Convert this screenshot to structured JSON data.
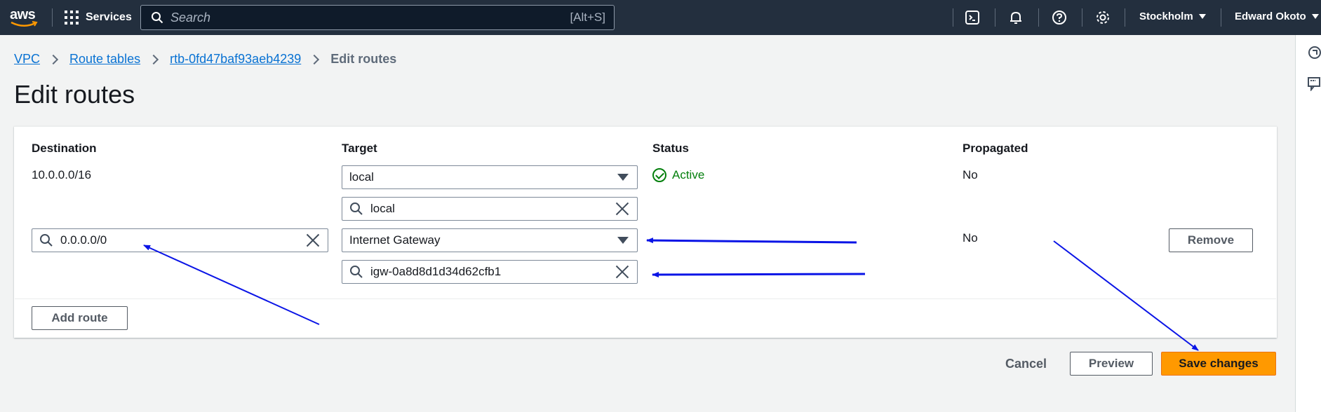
{
  "topnav": {
    "logo": "aws",
    "services_label": "Services",
    "search_placeholder": "Search",
    "search_shortcut": "[Alt+S]",
    "region": "Stockholm",
    "user": "Edward Okoto",
    "icons": [
      "cloudshell-icon",
      "notifications-icon",
      "help-icon",
      "settings-icon"
    ]
  },
  "breadcrumb": {
    "items": [
      "VPC",
      "Route tables",
      "rtb-0fd47baf93aeb4239"
    ],
    "current": "Edit routes"
  },
  "page": {
    "title": "Edit routes"
  },
  "table": {
    "headers": {
      "destination": "Destination",
      "target": "Target",
      "status": "Status",
      "propagated": "Propagated"
    },
    "rows": [
      {
        "destination": "10.0.0.0/16",
        "target_type": "local",
        "target_value": "local",
        "status": "Active",
        "propagated": "No"
      },
      {
        "destination": "0.0.0.0/0",
        "target_type": "Internet Gateway",
        "target_value": "igw-0a8d8d1d34d62cfb1",
        "status": "",
        "propagated": "No",
        "remove_label": "Remove"
      }
    ],
    "add_route_label": "Add route"
  },
  "footer": {
    "cancel_label": "Cancel",
    "preview_label": "Preview",
    "save_label": "Save changes"
  },
  "colors": {
    "nav_bg": "#232f3e",
    "link": "#0972d3",
    "status_active": "#037f0c",
    "primary": "#ff9900",
    "annotation": "#0a14e6"
  }
}
